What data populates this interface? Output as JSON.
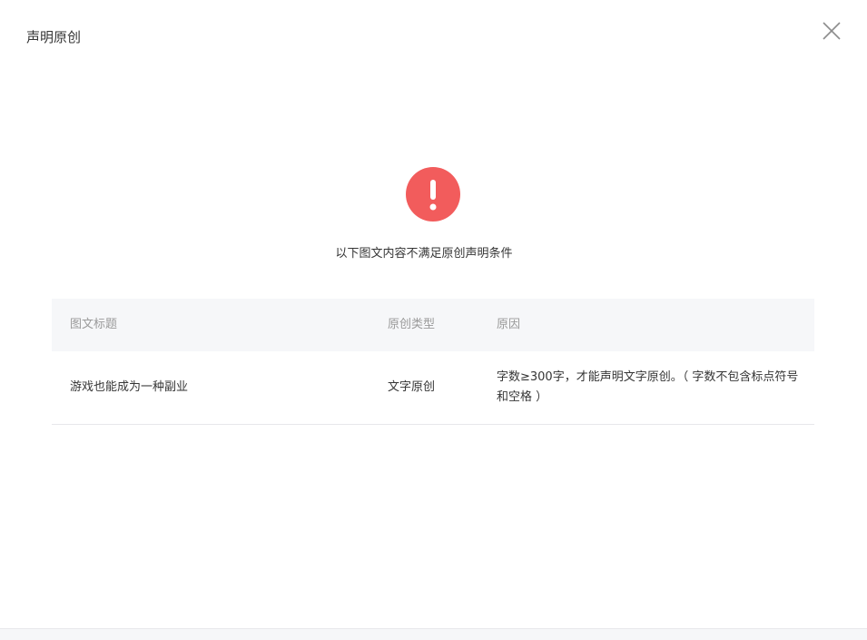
{
  "dialog": {
    "title": "声明原创",
    "close_icon": "close-icon"
  },
  "alert": {
    "icon": "exclamation-icon",
    "icon_color": "#f25c5c",
    "message": "以下图文内容不满足原创声明条件"
  },
  "table": {
    "headers": [
      "图文标题",
      "原创类型",
      "原因"
    ],
    "rows": [
      {
        "title": "游戏也能成为一种副业",
        "type": "文字原创",
        "reason": "字数≥300字，才能声明文字原创。（ 字数不包含标点符号和空格 ）"
      }
    ]
  }
}
